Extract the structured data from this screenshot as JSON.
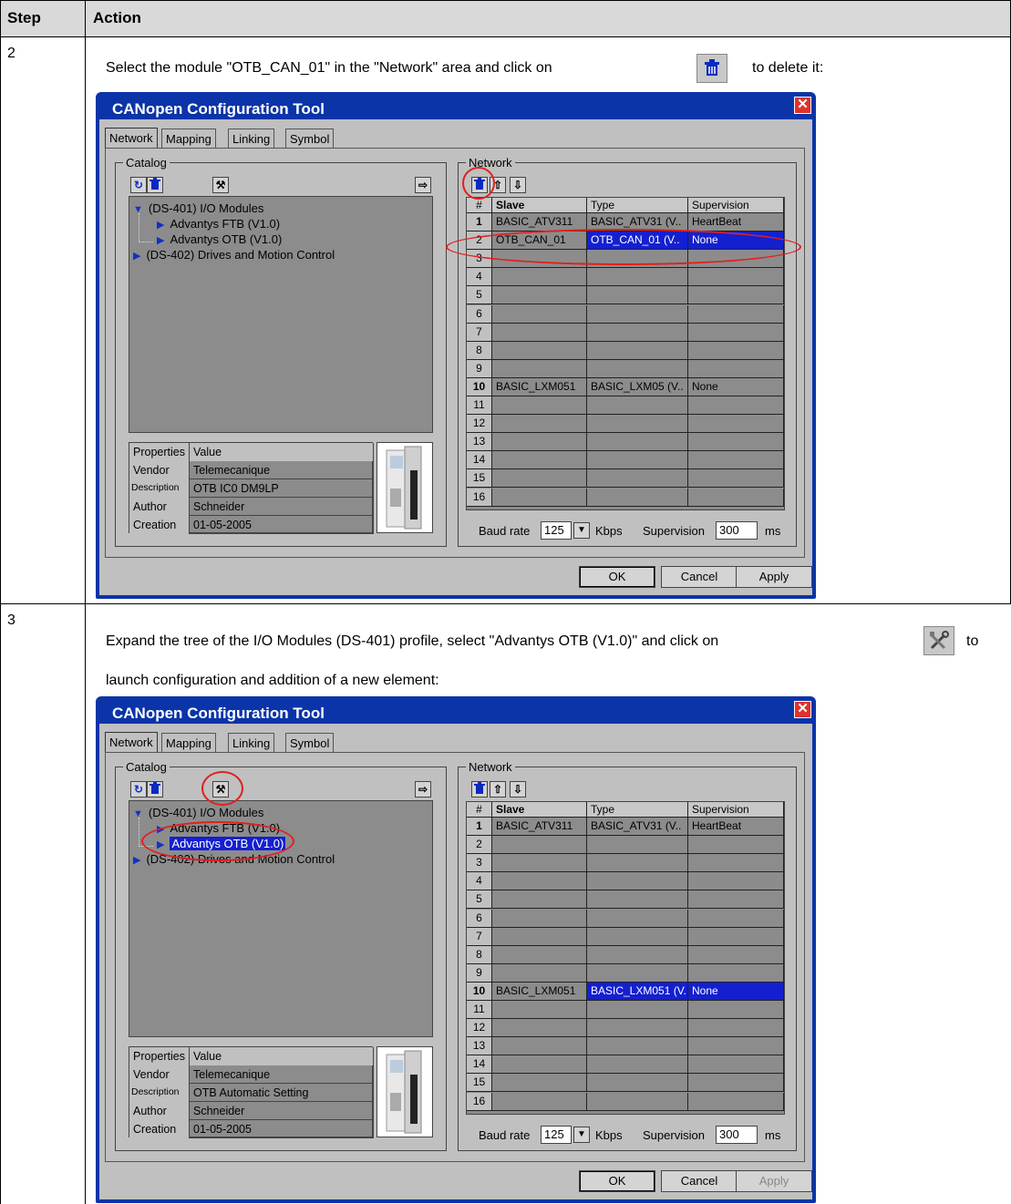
{
  "table": {
    "col_step": "Step",
    "col_action": "Action"
  },
  "rows": [
    {
      "step": "2",
      "instruction_before": "Select the module \"OTB_CAN_01\" in the \"Network\" area and click on",
      "instruction_after": "to delete it:",
      "icon": "trash-icon",
      "window": {
        "title": "CANopen Configuration Tool",
        "tabs": [
          "Network",
          "Mapping",
          "Linking",
          "Symbol"
        ],
        "catalog_label": "Catalog",
        "tree": [
          {
            "label": "(DS-401) I/O Modules",
            "level": 0,
            "selected": false
          },
          {
            "label": "Advantys FTB (V1.0)",
            "level": 1,
            "selected": false
          },
          {
            "label": "Advantys OTB (V1.0)",
            "level": 1,
            "selected": false
          },
          {
            "label": "(DS-402) Drives and Motion Control",
            "level": 0,
            "selected": false
          }
        ],
        "props_header": [
          "Properties",
          "Value"
        ],
        "props": [
          [
            "Vendor",
            "Telemecanique"
          ],
          [
            "Description",
            "OTB IC0 DM9LP"
          ],
          [
            "Author",
            "Schneider"
          ],
          [
            "Creation",
            "01-05-2005"
          ]
        ],
        "network_label": "Network",
        "grid_header": [
          "#",
          "Slave",
          "Type",
          "Supervision"
        ],
        "grid_rows": [
          [
            "1",
            "BASIC_ATV311",
            "BASIC_ATV31 (V..",
            "HeartBeat"
          ],
          [
            "2",
            "OTB_CAN_01",
            "OTB_CAN_01 (V..",
            "None"
          ],
          [
            "3",
            "",
            "",
            ""
          ],
          [
            "4",
            "",
            "",
            ""
          ],
          [
            "5",
            "",
            "",
            ""
          ],
          [
            "6",
            "",
            "",
            ""
          ],
          [
            "7",
            "",
            "",
            ""
          ],
          [
            "8",
            "",
            "",
            ""
          ],
          [
            "9",
            "",
            "",
            ""
          ],
          [
            "10",
            "BASIC_LXM051",
            "BASIC_LXM05 (V..",
            "None"
          ],
          [
            "11",
            "",
            "",
            ""
          ],
          [
            "12",
            "",
            "",
            ""
          ],
          [
            "13",
            "",
            "",
            ""
          ],
          [
            "14",
            "",
            "",
            ""
          ],
          [
            "15",
            "",
            "",
            ""
          ],
          [
            "16",
            "",
            "",
            ""
          ]
        ],
        "highlight_row": 1,
        "baud_label": "Baud rate",
        "baud_value": "125",
        "baud_unit": "Kbps",
        "sup_label": "Supervision",
        "sup_value": "300",
        "sup_unit": "ms",
        "buttons": {
          "ok": "OK",
          "cancel": "Cancel",
          "apply": "Apply"
        },
        "apply_disabled": false
      }
    },
    {
      "step": "3",
      "instruction_before": "Expand the tree of the I/O Modules (DS-401) profile, select \"Advantys OTB (V1.0)\" and click on",
      "instruction_after": "to",
      "instruction_line2": "launch configuration and addition of a new element:",
      "icon": "tools-icon",
      "window": {
        "title": "CANopen Configuration Tool",
        "tabs": [
          "Network",
          "Mapping",
          "Linking",
          "Symbol"
        ],
        "catalog_label": "Catalog",
        "tree": [
          {
            "label": "(DS-401) I/O Modules",
            "level": 0,
            "selected": false
          },
          {
            "label": "Advantys FTB (V1.0)",
            "level": 1,
            "selected": false
          },
          {
            "label": "Advantys OTB (V1.0)",
            "level": 1,
            "selected": true
          },
          {
            "label": "(DS-402) Drives and Motion Control",
            "level": 0,
            "selected": false
          }
        ],
        "props_header": [
          "Properties",
          "Value"
        ],
        "props": [
          [
            "Vendor",
            "Telemecanique"
          ],
          [
            "Description",
            "OTB Automatic Setting"
          ],
          [
            "Author",
            "Schneider"
          ],
          [
            "Creation",
            "01-05-2005"
          ]
        ],
        "network_label": "Network",
        "grid_header": [
          "#",
          "Slave",
          "Type",
          "Supervision"
        ],
        "grid_rows": [
          [
            "1",
            "BASIC_ATV311",
            "BASIC_ATV31 (V..",
            "HeartBeat"
          ],
          [
            "2",
            "",
            "",
            ""
          ],
          [
            "3",
            "",
            "",
            ""
          ],
          [
            "4",
            "",
            "",
            ""
          ],
          [
            "5",
            "",
            "",
            ""
          ],
          [
            "6",
            "",
            "",
            ""
          ],
          [
            "7",
            "",
            "",
            ""
          ],
          [
            "8",
            "",
            "",
            ""
          ],
          [
            "9",
            "",
            "",
            ""
          ],
          [
            "10",
            "BASIC_LXM051",
            "BASIC_LXM051 (V..",
            "None"
          ],
          [
            "11",
            "",
            "",
            ""
          ],
          [
            "12",
            "",
            "",
            ""
          ],
          [
            "13",
            "",
            "",
            ""
          ],
          [
            "14",
            "",
            "",
            ""
          ],
          [
            "15",
            "",
            "",
            ""
          ],
          [
            "16",
            "",
            "",
            ""
          ]
        ],
        "highlight_row": 9,
        "baud_label": "Baud rate",
        "baud_value": "125",
        "baud_unit": "Kbps",
        "sup_label": "Supervision",
        "sup_value": "300",
        "sup_unit": "ms",
        "buttons": {
          "ok": "OK",
          "cancel": "Cancel",
          "apply": "Apply"
        },
        "apply_disabled": true
      }
    }
  ]
}
